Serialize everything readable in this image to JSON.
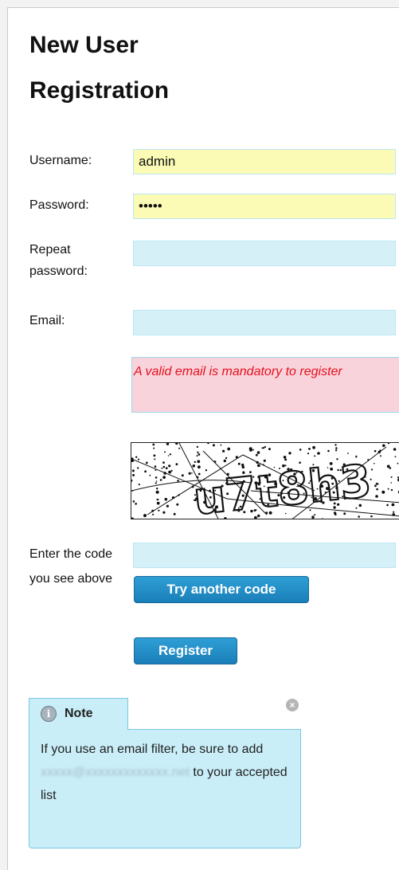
{
  "form": {
    "title": "New User Registration",
    "username_label": "Username:",
    "username_value": "admin",
    "password_label": "Password:",
    "password_value": "admin",
    "repeat_label": "Repeat password:",
    "email_label": "Email:",
    "error_text": "A valid email is mandatory to register",
    "captcha_label": "Enter the code you see above",
    "captcha_text": "u7t8h3",
    "try_another_label": "Try another code",
    "register_label": "Register"
  },
  "note": {
    "tab_label": "Note",
    "text_before": "If you use an email filter, be sure to add",
    "blurred_email": "xxxxx@xxxxxxxxxxxxx.net",
    "text_after": "to your accepted list"
  }
}
